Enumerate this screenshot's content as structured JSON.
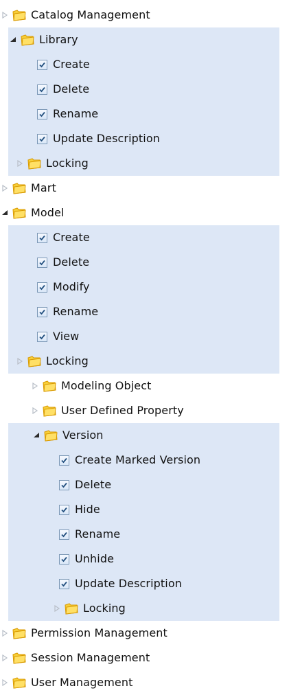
{
  "tree": {
    "items": [
      {
        "label": "Catalog Management"
      },
      {
        "label": "Library"
      },
      {
        "label": "Create"
      },
      {
        "label": "Delete"
      },
      {
        "label": "Rename"
      },
      {
        "label": "Update Description"
      },
      {
        "label": "Locking"
      },
      {
        "label": "Mart"
      },
      {
        "label": "Model"
      },
      {
        "label": "Create"
      },
      {
        "label": "Delete"
      },
      {
        "label": "Modify"
      },
      {
        "label": "Rename"
      },
      {
        "label": "View"
      },
      {
        "label": "Locking"
      },
      {
        "label": "Modeling Object"
      },
      {
        "label": "User Defined Property"
      },
      {
        "label": "Version"
      },
      {
        "label": "Create Marked Version"
      },
      {
        "label": "Delete"
      },
      {
        "label": "Hide"
      },
      {
        "label": "Rename"
      },
      {
        "label": "Unhide"
      },
      {
        "label": "Update Description"
      },
      {
        "label": "Locking"
      },
      {
        "label": "Permission Management"
      },
      {
        "label": "Session Management"
      },
      {
        "label": "User Management"
      }
    ]
  },
  "colors": {
    "selection_background": "#dde7f6",
    "text": "#111111",
    "folder": "#f4c430",
    "folder_shadow": "#d89b00",
    "checkbox_border": "#7c98b6",
    "check": "#23507f"
  },
  "icons": {
    "collapsed": "triangle-right-icon",
    "expanded": "triangle-down-icon",
    "folder": "folder-icon",
    "checkbox": "checked-box-icon"
  }
}
